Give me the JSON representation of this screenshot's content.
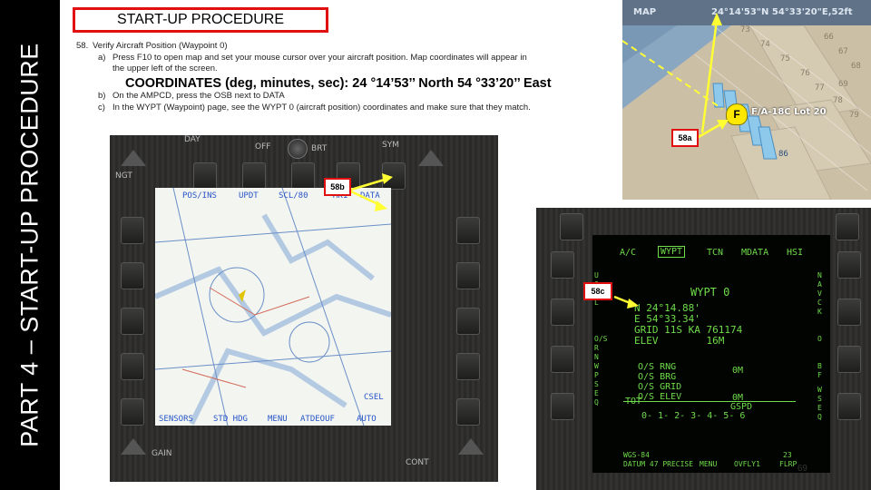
{
  "side_title": "PART 4 – START-UP PROCEDURE",
  "section_title": "START-UP PROCEDURE",
  "step": {
    "number": "58.",
    "heading": "Verify Aircraft Position (Waypoint 0)",
    "a_label": "a)",
    "a_text": "Press F10 to open map and set your mouse cursor over your aircraft position. Map coordinates will appear in",
    "a_text2": "the upper left of the screen.",
    "coordinates": "COORDINATES (deg, minutes, sec): 24 °14’53’’ North 54 °33’20’’ East",
    "b_label": "b)",
    "b_text": "On the AMPCD, press the OSB next to DATA",
    "c_label": "c)",
    "c_text": "In the WYPT (Waypoint) page, see the WYPT 0 (aircraft position) coordinates and make sure that they match."
  },
  "page_number": "69",
  "callouts": {
    "c58a": "58a",
    "c58b": "58b",
    "c58c": "58c"
  },
  "f10_map": {
    "header_label": "MAP",
    "header_coords": "24°14'53\"N 54°33'20\"E,52ft",
    "aircraft_label": "F/A-18C Lot 20",
    "aircraft_marker": "F",
    "grid_numbers": [
      "73",
      "74",
      "75",
      "66",
      "67",
      "68",
      "76",
      "69",
      "77",
      "78",
      "79",
      "86"
    ]
  },
  "ampcd": {
    "top_labels": [
      "DAY",
      "OFF",
      "BRT",
      "SYM"
    ],
    "left_labels": [
      "NGT"
    ],
    "bottom_labels": [
      "GAIN",
      "CONT"
    ],
    "screen_top": [
      "POS/INS",
      "UPDT",
      "SCL/80",
      "MK1",
      "DATA"
    ],
    "screen_bottom": [
      "SENSORS",
      "STD HDG",
      "MENU",
      "ATDEOUF",
      "AUTO"
    ],
    "screen_right": [
      "CSEL"
    ]
  },
  "ddi": {
    "top_tabs": [
      "A/C",
      "WYPT",
      "TCN",
      "MDATA",
      "HSI"
    ],
    "title": "WYPT 0",
    "lines": [
      "N 24°14.88'",
      "E 54°33.34'",
      "GRID 11S KA 761174",
      "ELEV        16M"
    ],
    "os_lines": [
      "O/S RNG",
      "O/S BRG",
      "O/S GRID",
      "O/S ELEV"
    ],
    "os_values": [
      "0M",
      "0M"
    ],
    "tot_label": "TOT",
    "gspd_label": "GSPD",
    "seq": "0- 1- 2- 3- 4- 5- 6",
    "bottom": [
      "WGS-84",
      "DATUM 47 PRECISE",
      "MENU",
      "OVFLY1",
      "23",
      "FLRP"
    ],
    "left_side": [
      "U",
      "S",
      "E",
      "L",
      "O/S",
      "R",
      "N",
      "W",
      "P",
      "S",
      "E",
      "Q"
    ],
    "right_side": [
      "N",
      "A",
      "V",
      "C",
      "K",
      "O",
      "B",
      "F",
      "W",
      "S",
      "E",
      "Q"
    ]
  }
}
